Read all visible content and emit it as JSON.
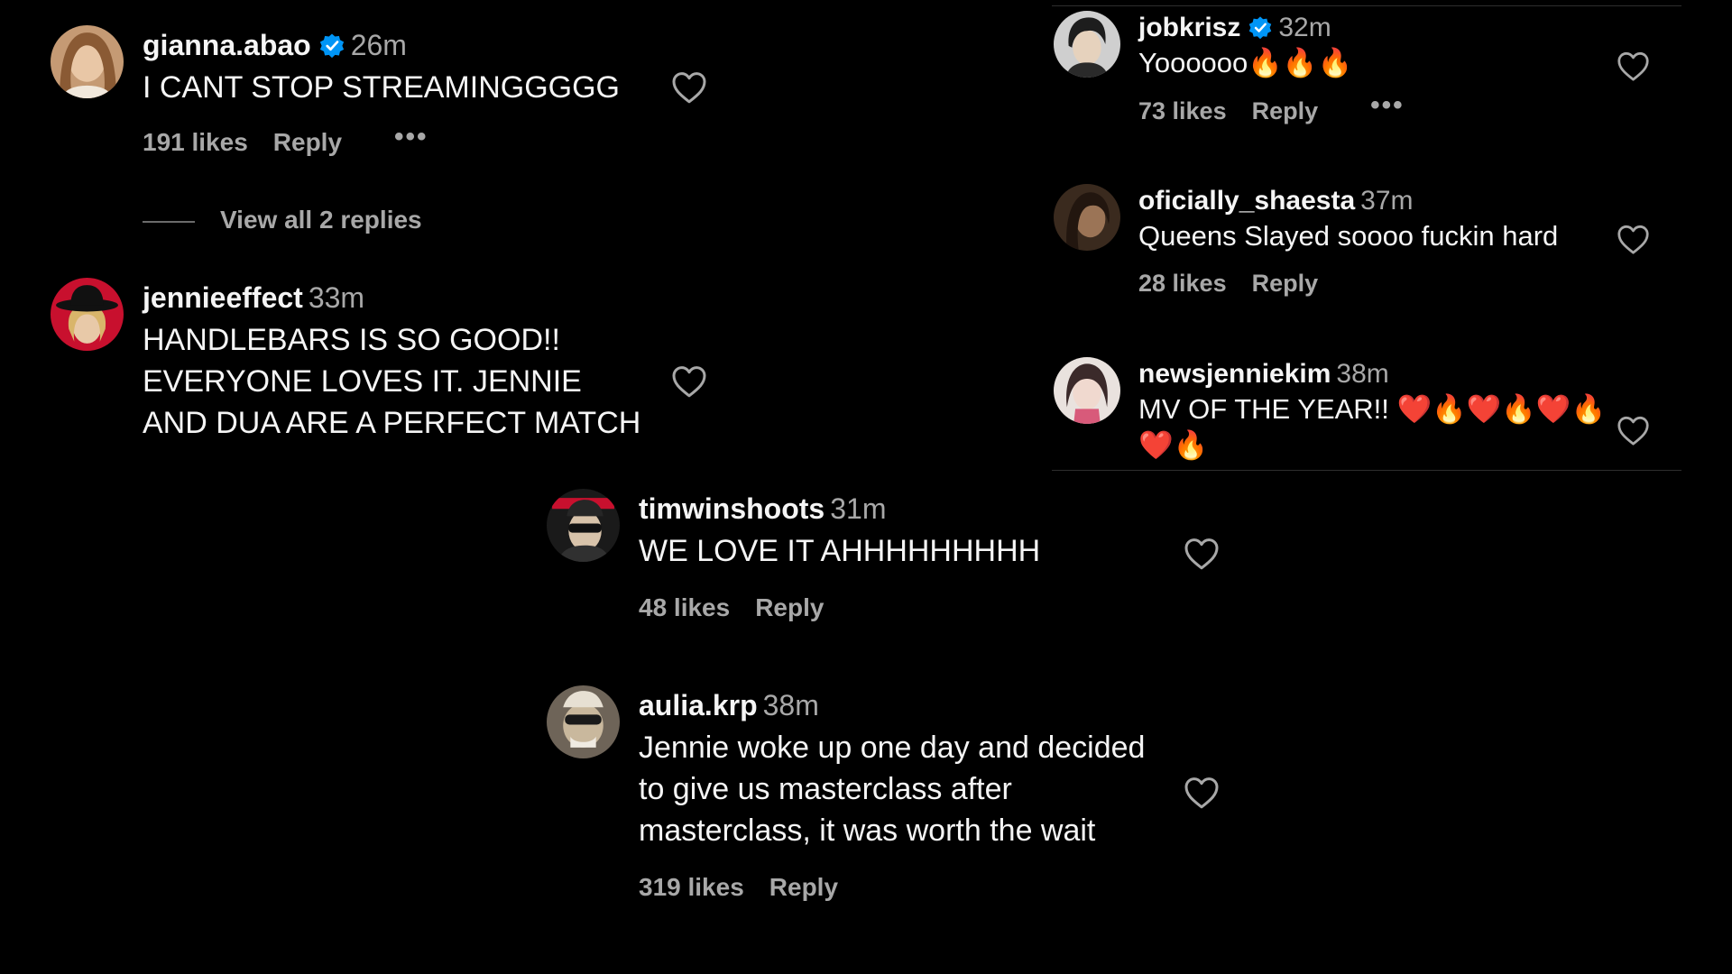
{
  "comments": [
    {
      "username": "gianna.abao",
      "verified": true,
      "time": "26m",
      "text": "I CANT STOP STREAMINGGGGG",
      "likes": "191 likes",
      "reply": "Reply",
      "more": "•••",
      "view_replies": "View all 2 replies"
    },
    {
      "username": "jennieeffect",
      "verified": false,
      "time": "33m",
      "text": "HANDLEBARS IS SO GOOD!! EVERYONE LOVES IT. JENNIE AND DUA ARE A PERFECT MATCH"
    },
    {
      "username": "jobkrisz",
      "verified": true,
      "time": "32m",
      "text": "Yoooooo🔥🔥🔥",
      "likes": "73 likes",
      "reply": "Reply",
      "more": "•••"
    },
    {
      "username": "oficially_shaesta",
      "verified": false,
      "time": "37m",
      "text": "Queens Slayed soooo fuckin hard",
      "likes": "28 likes",
      "reply": "Reply"
    },
    {
      "username": "newsjenniekim",
      "verified": false,
      "time": "38m",
      "text": "MV OF THE YEAR!! ❤️🔥❤️🔥❤️🔥❤️🔥"
    },
    {
      "username": "timwinshoots",
      "verified": false,
      "time": "31m",
      "text": "WE LOVE IT AHHHHHHHHH",
      "likes": "48 likes",
      "reply": "Reply"
    },
    {
      "username": "aulia.krp",
      "verified": false,
      "time": "38m",
      "text": "Jennie woke up one day and decided to give us masterclass after masterclass, it was worth the wait",
      "likes": "319 likes",
      "reply": "Reply"
    }
  ],
  "colors": {
    "background": "#000000",
    "primary_text": "#f5f5f5",
    "secondary_text": "#a8a8a8",
    "verified_badge": "#0095f6",
    "heart_outline": "#a8a8a8",
    "fire_emoji": "#ff8a00",
    "heart_emoji": "#e8142a"
  },
  "icons": {
    "like": "heart-outline-icon",
    "verified": "verified-badge-icon",
    "more": "more-options-icon"
  }
}
